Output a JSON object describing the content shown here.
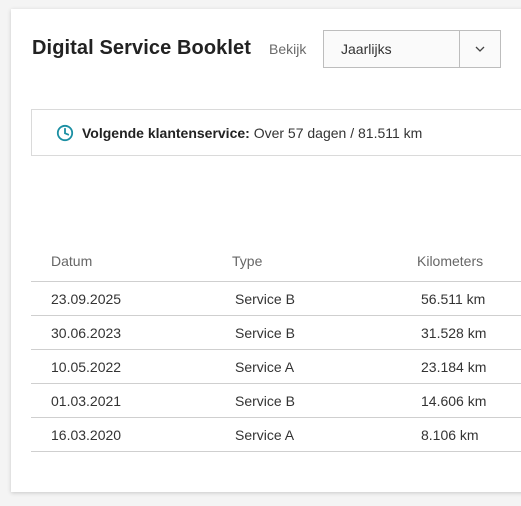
{
  "header": {
    "title": "Digital Service Booklet",
    "view_label": "Bekijk",
    "view_select": {
      "value": "Jaarlijks",
      "arrow_icon": "chevron-down-icon"
    }
  },
  "next_service": {
    "icon": "clock-icon",
    "icon_color": "#1b8fa3",
    "label": "Volgende klantenservice:",
    "value": "Over 57 dagen / 81.511 km"
  },
  "table": {
    "columns": [
      "Datum",
      "Type",
      "Kilometers"
    ],
    "rows": [
      {
        "date": "23.09.2025",
        "type": "Service B",
        "km": "56.511 km"
      },
      {
        "date": "30.06.2023",
        "type": "Service B",
        "km": "31.528 km"
      },
      {
        "date": "10.05.2022",
        "type": "Service A",
        "km": "23.184 km"
      },
      {
        "date": "01.03.2021",
        "type": "Service B",
        "km": "14.606 km"
      },
      {
        "date": "16.03.2020",
        "type": "Service A",
        "km": "8.106 km"
      }
    ]
  }
}
